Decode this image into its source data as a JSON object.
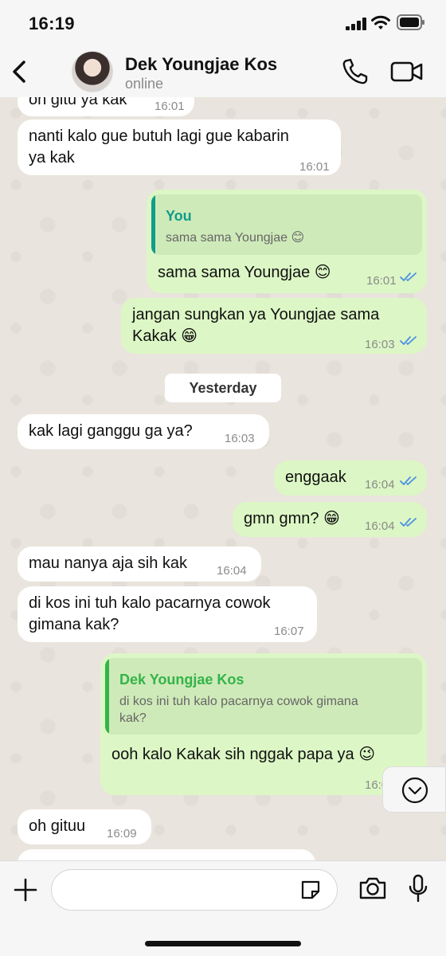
{
  "status_bar": {
    "time": "16:19"
  },
  "header": {
    "contact_name": "Dek Youngjae Kos",
    "contact_status": "online",
    "icons": [
      "back-chevron-icon",
      "phone-icon",
      "video-camera-icon"
    ]
  },
  "chat": {
    "messages": [
      {
        "dir": "in",
        "text": "oh gitu ya kak",
        "time": "16:01"
      },
      {
        "dir": "in",
        "text": "nanti kalo gue butuh lagi gue kabarin",
        "text2": "ya kak",
        "time": "16:01"
      },
      {
        "dir": "out",
        "quote_author": "You",
        "quote_text": "sama sama Youngjae 😊",
        "text": "sama sama Youngjae 😊",
        "time": "16:01",
        "read": true
      },
      {
        "dir": "out",
        "text": "jangan sungkan ya Youngjae sama",
        "text2": "Kakak 😁",
        "time": "16:03",
        "read": true
      },
      {
        "dir": "in",
        "text": "kak lagi ganggu ga ya?",
        "time": "16:03"
      },
      {
        "dir": "out",
        "text": "enggaak",
        "time": "16:04",
        "read": true
      },
      {
        "dir": "out",
        "text": "gmn gmn? 😁",
        "time": "16:04",
        "read": true
      },
      {
        "dir": "in",
        "text": "mau nanya aja sih kak",
        "time": "16:04"
      },
      {
        "dir": "in",
        "text": "di kos ini tuh kalo pacarnya cowok",
        "text2": "gimana kak?",
        "time": "16:07"
      },
      {
        "dir": "out",
        "quote_author": "Dek Youngjae Kos",
        "quote_text": "di kos ini tuh kalo pacarnya cowok gimana",
        "quote_text2": "kak?",
        "text": "ooh kalo Kakak sih nggak papa ya 😉",
        "time": "16:0",
        "read": false
      },
      {
        "dir": "in",
        "text": "oh gituu",
        "time": "16:09"
      }
    ],
    "date_separator": "Yesterday"
  },
  "input": {
    "value": "",
    "placeholder": ""
  },
  "colors": {
    "outgoing": "#dcf7c5",
    "incoming": "#ffffff",
    "read_ticks": "#4a90e2",
    "you_quote": "#0f9d8a",
    "contact_quote": "#33b449"
  }
}
